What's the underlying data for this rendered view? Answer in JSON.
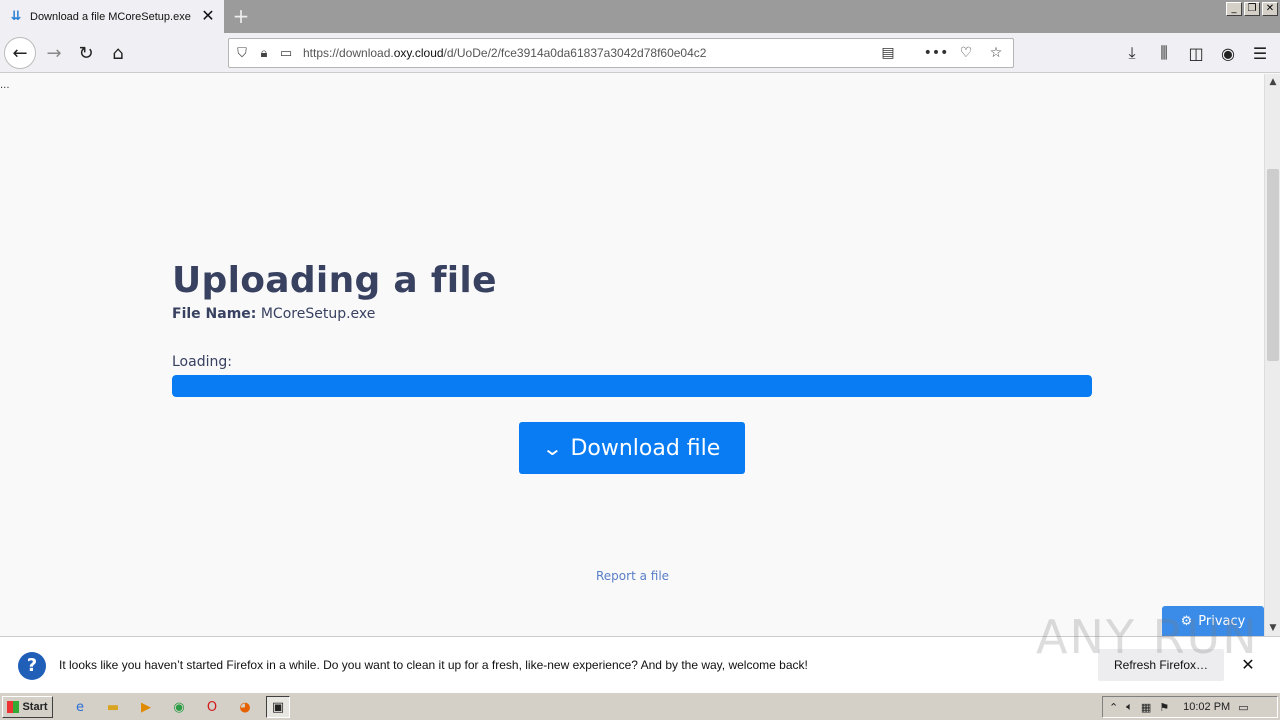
{
  "browser": {
    "tab_title": "Download a file MCoreSetup.exe o",
    "favicon": "download-cloud-icon",
    "new_tab_label": "+",
    "url_prefix": "https://download.",
    "url_domain": "oxy.cloud",
    "url_path": "/d/UoDe/2/fce3914a0da61837a3042d78f60e04c2"
  },
  "page": {
    "ellipsis": "...",
    "heading": "Uploading a file",
    "file_name_label": "File Name:",
    "file_name_value": "MCoreSetup.exe",
    "loading_label": "Loading:",
    "progress_fraction": 1.0,
    "download_button_label": "Download file",
    "report_link": "Report a file",
    "privacy_button_label": "Privacy",
    "accent_color": "#0a7cf3"
  },
  "notification": {
    "message": "It looks like you haven’t started Firefox in a while. Do you want to clean it up for a fresh, like-new experience? And by the way, welcome back!",
    "refresh_button_label": "Refresh Firefox…"
  },
  "watermark": "ANY RUN",
  "taskbar": {
    "start_label": "Start",
    "clock": "10:02 PM"
  }
}
